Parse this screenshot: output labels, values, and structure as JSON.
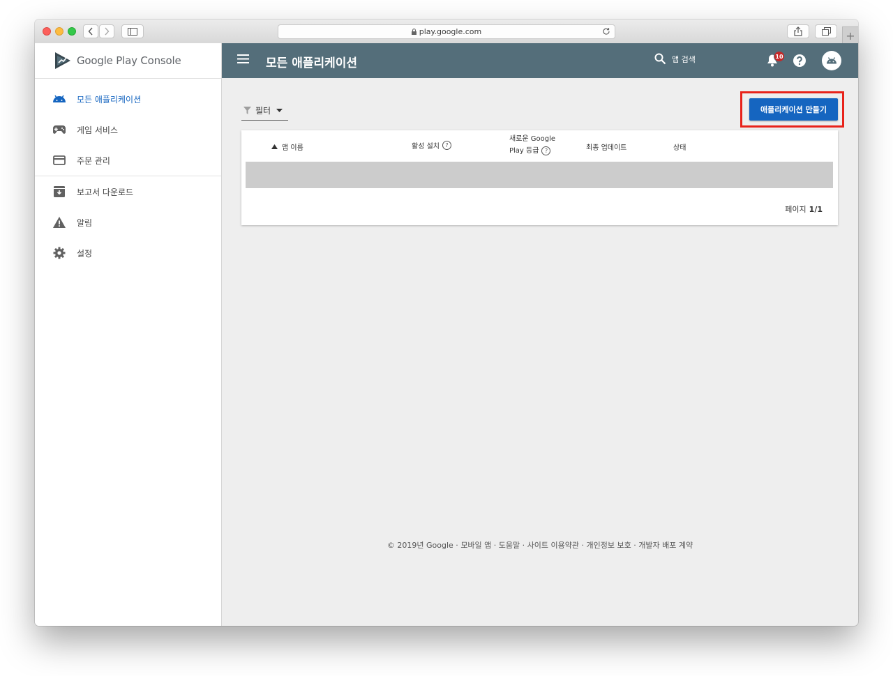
{
  "browser": {
    "url": "play.google.com",
    "new_tab_label": "+"
  },
  "brand": {
    "name_part1": "Google Play",
    "name_part2": "Console"
  },
  "sidebar": {
    "items": [
      {
        "label": "모든 애플리케이션",
        "icon": "android-icon",
        "active": true
      },
      {
        "label": "게임 서비스",
        "icon": "gamepad-icon"
      },
      {
        "label": "주문 관리",
        "icon": "credit-card-icon"
      },
      {
        "label": "보고서 다운로드",
        "icon": "archive-download-icon"
      },
      {
        "label": "알림",
        "icon": "warning-icon"
      },
      {
        "label": "설정",
        "icon": "gear-icon"
      }
    ]
  },
  "header": {
    "title": "모든 애플리케이션",
    "search_label": "앱 검색",
    "notification_count": "10"
  },
  "toolbar": {
    "filter_label": "필터",
    "create_button_label": "애플리케이션 만들기"
  },
  "table": {
    "columns": {
      "app_name": "앱 이름",
      "active_installs": "활성 설치",
      "rating_line1": "새로운 Google",
      "rating_line2": "Play 등급",
      "last_update": "최종 업데이트",
      "status": "상태"
    },
    "pager_label": "페이지",
    "pager_value": "1/1"
  },
  "footer": {
    "copyright": "© 2019년 Google",
    "links": [
      "모바일 앱",
      "도움말",
      "사이트 이용약관",
      "개인정보 보호",
      "개발자 배포 계약"
    ],
    "separator": " · "
  },
  "colors": {
    "header_bg": "#546e7a",
    "primary_button": "#1565c0",
    "highlight_border": "#e8231b",
    "active_nav": "#1565c0"
  }
}
